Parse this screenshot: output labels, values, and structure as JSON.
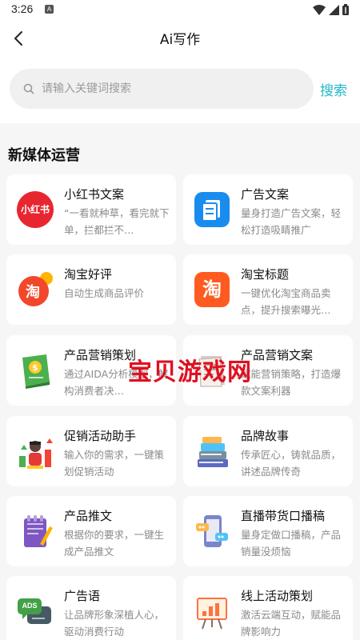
{
  "status_bar": {
    "time": "3:26",
    "app_icon": "A"
  },
  "header": {
    "title": "Ai写作",
    "back_icon": "back-arrow-icon"
  },
  "search": {
    "placeholder": "请输入关键词搜索",
    "value": "",
    "button_label": "搜索"
  },
  "section": {
    "title": "新媒体运营"
  },
  "cards": [
    {
      "title": "小红书文案",
      "desc": "“一看就种草，看完就下单，拦都拦不…",
      "icon": "xiaohongshu-logo-icon",
      "icon_text": "小红书"
    },
    {
      "title": "广告文案",
      "desc": "量身打造广告文案，轻松打造吸睛推广",
      "icon": "document-icon"
    },
    {
      "title": "淘宝好评",
      "desc": "自动生成商品评价",
      "icon": "taobao-badge-icon",
      "icon_text": "淘"
    },
    {
      "title": "淘宝标题",
      "desc": "一键优化淘宝商品卖点，提升搜索曝光…",
      "icon": "taobao-logo-icon",
      "icon_text": "淘"
    },
    {
      "title": "产品营销策划",
      "desc": "通过AIDA分析模型，解构消费者决…",
      "icon": "money-book-icon"
    },
    {
      "title": "产品营销文案",
      "desc": "赋能营销策略，打造爆款文案利器",
      "icon": "paper-stack-icon"
    },
    {
      "title": "促销活动助手",
      "desc": "输入你的需求，一键策划促销活动",
      "icon": "growth-character-icon"
    },
    {
      "title": "品牌故事",
      "desc": "传承匠心，铸就品质，讲述品牌传奇",
      "icon": "books-stack-icon"
    },
    {
      "title": "产品推文",
      "desc": "根据你的要求，一键生成产品推文",
      "icon": "notepad-pen-icon"
    },
    {
      "title": "直播带货口播稿",
      "desc": "量身定做口播稿，产品销量没烦恼",
      "icon": "phone-chat-icon"
    },
    {
      "title": "广告语",
      "desc": "让品牌形象深植人心，驱动消费行动",
      "icon": "ads-bubble-icon",
      "icon_text": "ADS"
    },
    {
      "title": "线上活动策划",
      "desc": "激活云端互动，赋能品牌影响力",
      "icon": "presentation-board-icon"
    }
  ],
  "watermark": {
    "text": "宝贝游戏网"
  },
  "colors": {
    "accent": "#1fb8c9",
    "background": "#f6f6f6",
    "card": "#ffffff",
    "watermark": "#e01020"
  }
}
